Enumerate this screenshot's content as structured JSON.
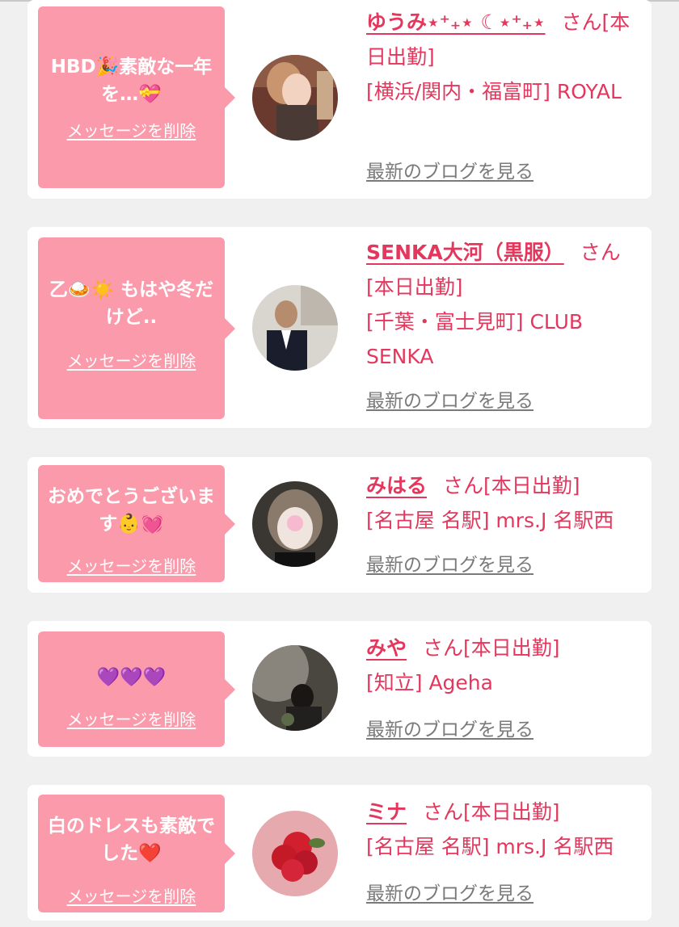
{
  "colors": {
    "background": "#f0f0f0",
    "card": "#ffffff",
    "bubble": "#fb9aab",
    "accent": "#e4375d",
    "link_gray": "#7a7a7a"
  },
  "cards": [
    {
      "message": "HBD🎉素敵な一年を…💝",
      "delete_label": "メッセージを削除",
      "name": "ゆうみ⋆⁺₊⋆ ☾⋆⁺₊⋆",
      "suffix": "さん[本日出勤]",
      "location": "[横浜/関内・福富町] ROYAL",
      "blog_label": "最新のブログを見る"
    },
    {
      "message": "乙🍛☀️ もはや冬だけど..",
      "delete_label": "メッセージを削除",
      "name": "SENKA大河（黒服）",
      "suffix": "さん[本日出勤]",
      "location": "[千葉・富士見町] CLUB SENKA",
      "blog_label": "最新のブログを見る"
    },
    {
      "message": "おめでとうございます👶💓",
      "delete_label": "メッセージを削除",
      "name": "みはる",
      "suffix": "さん[本日出勤]",
      "location": "[名古屋 名駅] mrs.J 名駅西",
      "blog_label": "最新のブログを見る"
    },
    {
      "message": "💜💜💜",
      "delete_label": "メッセージを削除",
      "name": "みや",
      "suffix": "さん[本日出勤]",
      "location": "[知立] Ageha",
      "blog_label": "最新のブログを見る"
    },
    {
      "message": "白のドレスも素敵でした❤️",
      "delete_label": "メッセージを削除",
      "name": "ミナ",
      "suffix": "さん[本日出勤]",
      "location": "[名古屋 名駅] mrs.J 名駅西",
      "blog_label": "最新のブログを見る"
    }
  ]
}
